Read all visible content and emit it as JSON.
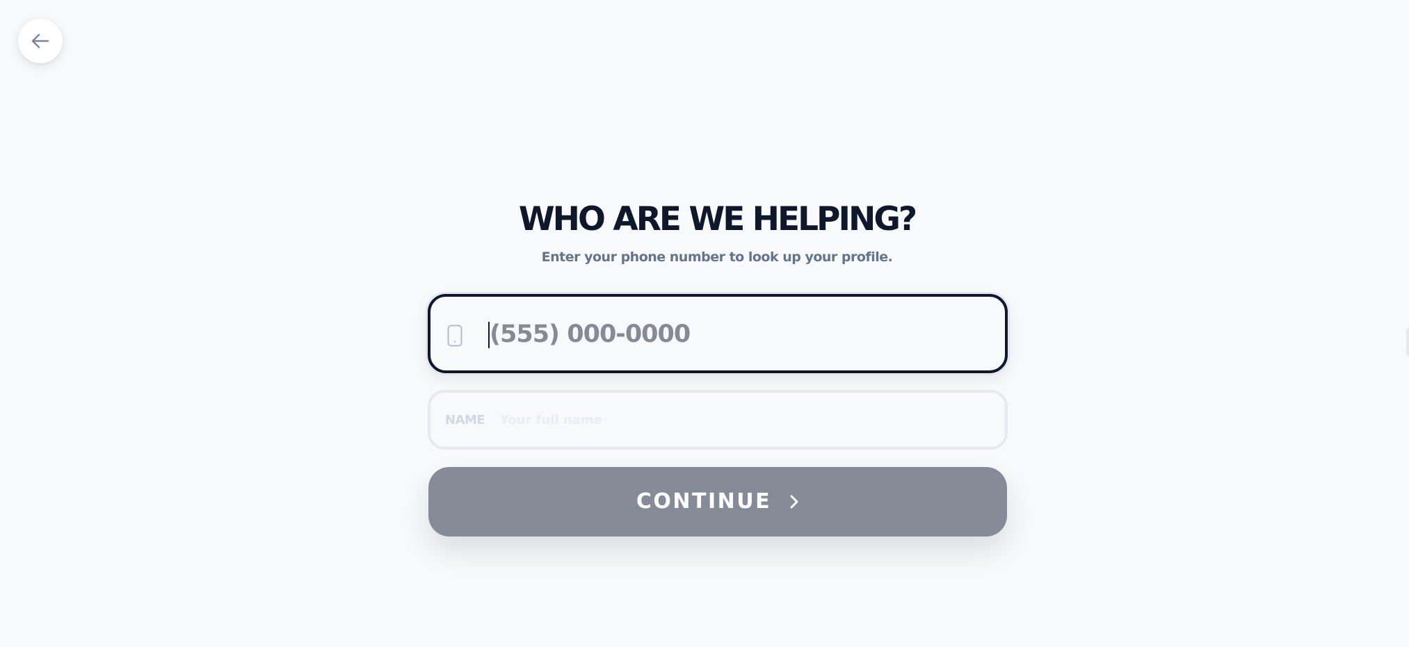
{
  "colors": {
    "background": "#f8f9fb",
    "heading": "#0f172a",
    "subtext": "#64748b",
    "field_border_active": "#0f172a",
    "field_border_inactive": "#e2e8f0",
    "placeholder": "#858b96",
    "button_disabled": "#868c97",
    "button_text": "#ffffff"
  },
  "header": {
    "back_icon": "arrow-left-icon"
  },
  "main": {
    "title": "WHO ARE WE HELPING?",
    "subtitle": "Enter your phone number to look up your profile."
  },
  "phone_input": {
    "icon": "smartphone-icon",
    "placeholder": "(555) 000-0000",
    "value": "",
    "focused": true
  },
  "name_input": {
    "label": "NAME",
    "placeholder": "Your full name",
    "disabled": true
  },
  "continue_button": {
    "label": "CONTINUE",
    "icon": "chevron-right-icon",
    "disabled": true
  }
}
